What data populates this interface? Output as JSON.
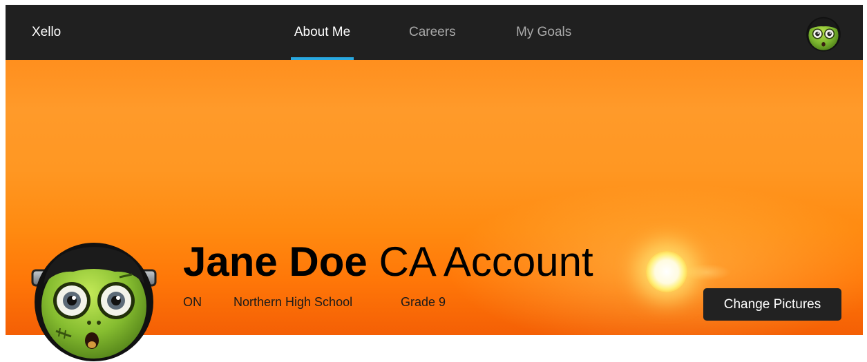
{
  "header": {
    "brand": "Xello",
    "nav": [
      {
        "label": "About Me",
        "active": true
      },
      {
        "label": "Careers",
        "active": false
      },
      {
        "label": "My Goals",
        "active": false
      }
    ],
    "avatar_icon": "monster-avatar-icon"
  },
  "profile": {
    "first_name": "Jane Doe",
    "rest_name": " CA Account",
    "province": "ON",
    "school": "Northern High School",
    "grade": "Grade 9",
    "change_pictures_label": "Change Pictures",
    "avatar_icon": "monster-avatar-icon"
  },
  "colors": {
    "topbar": "#202020",
    "nav_active_underline": "#29a8e0",
    "banner_top": "#ff8f1e",
    "banner_bottom": "#f45f05",
    "button_bg": "#222222",
    "avatar_skin": "#7ab52e"
  }
}
